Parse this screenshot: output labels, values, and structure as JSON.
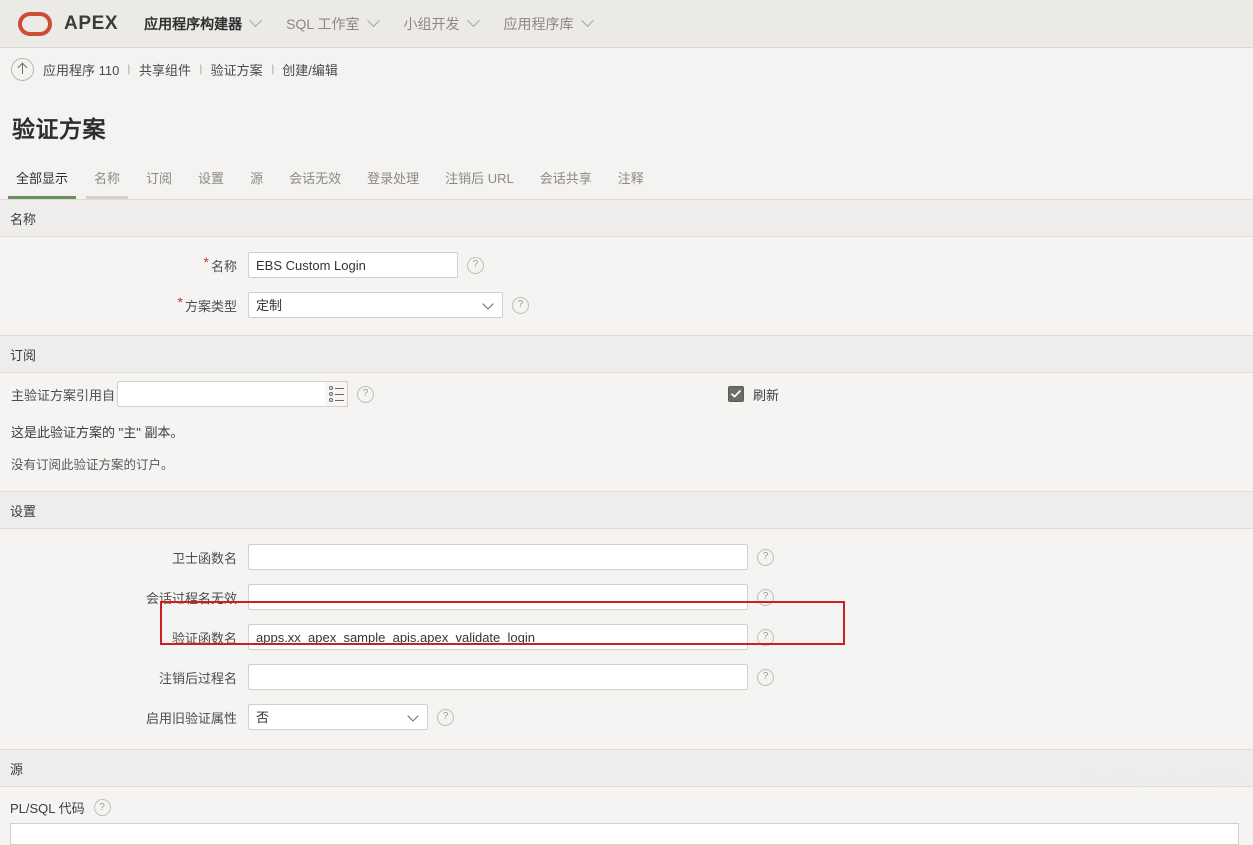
{
  "topnav": {
    "logo_label": "APEX",
    "logo_color": "#cf4b36",
    "items": [
      {
        "label": "应用程序构建器",
        "active": true,
        "has_chevron": true
      },
      {
        "label": "SQL 工作室",
        "active": false,
        "has_chevron": true
      },
      {
        "label": "小组开发",
        "active": false,
        "has_chevron": true
      },
      {
        "label": "应用程序库",
        "active": false,
        "has_chevron": true
      }
    ]
  },
  "breadcrumb": {
    "up_icon": "arrow-up-icon",
    "items": [
      "应用程序 110",
      "共享组件",
      "验证方案",
      "创建/编辑"
    ],
    "separator": "\\"
  },
  "page": {
    "title": "验证方案"
  },
  "tabs": [
    {
      "label": "全部显示",
      "state": "active"
    },
    {
      "label": "名称",
      "state": "hovered"
    },
    {
      "label": "订阅",
      "state": "normal"
    },
    {
      "label": "设置",
      "state": "normal"
    },
    {
      "label": "源",
      "state": "normal"
    },
    {
      "label": "会话无效",
      "state": "normal"
    },
    {
      "label": "登录处理",
      "state": "normal"
    },
    {
      "label": "注销后 URL",
      "state": "normal"
    },
    {
      "label": "会话共享",
      "state": "normal"
    },
    {
      "label": "注释",
      "state": "normal"
    }
  ],
  "section_name": {
    "header": "名称",
    "fields": [
      {
        "label": "名称",
        "required": true,
        "value": "EBS Custom Login",
        "type": "text"
      },
      {
        "label": "方案类型",
        "required": true,
        "value": "定制",
        "type": "select"
      }
    ]
  },
  "section_subscription": {
    "header": "订阅",
    "field_label": "主验证方案引用自",
    "field_value": "",
    "lov_icon": "list-lov-icon",
    "checkbox": {
      "label": "刷新",
      "checked": true
    },
    "notes": [
      "这是此验证方案的 \"主\" 副本。",
      "没有订阅此验证方案的订户。"
    ]
  },
  "section_settings": {
    "header": "设置",
    "fields": [
      {
        "label": "卫士函数名",
        "value": "",
        "type": "text",
        "highlighted": false
      },
      {
        "label": "会话过程名无效",
        "value": "",
        "type": "text",
        "highlighted": false
      },
      {
        "label": "验证函数名",
        "value": "apps.xx_apex_sample_apis.apex_validate_login",
        "type": "text",
        "highlighted": true
      },
      {
        "label": "注销后过程名",
        "value": "",
        "type": "text",
        "highlighted": false
      },
      {
        "label": "启用旧验证属性",
        "value": "否",
        "type": "select",
        "highlighted": false
      }
    ]
  },
  "section_source": {
    "header": "源",
    "code_label": "PL/SQL 代码",
    "code_value": ""
  },
  "watermark": "https://blog.csdn.net/x6_9x",
  "colors": {
    "accent_green": "#6b8f5e",
    "highlight_red": "#cc1f1f",
    "required_red": "#c0392b",
    "section_header_bg": "#eeedeb",
    "section_body_bg": "#f5f4f2",
    "topnav_bg": "#eceae7"
  }
}
